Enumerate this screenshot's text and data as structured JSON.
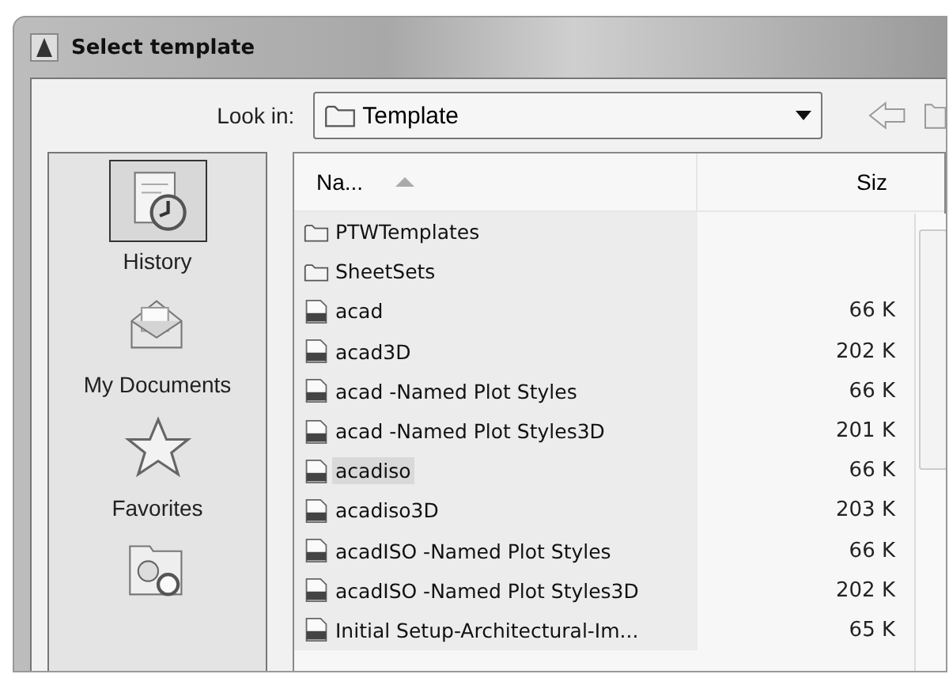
{
  "window": {
    "title": "Select template"
  },
  "look_in": {
    "label": "Look in:",
    "value": "Template"
  },
  "sidebar": {
    "items": [
      {
        "label": "History",
        "kind": "history",
        "selected": true
      },
      {
        "label": "My Documents",
        "kind": "documents",
        "selected": false
      },
      {
        "label": "Favorites",
        "kind": "favorites",
        "selected": false
      },
      {
        "kind": "search",
        "selected": false
      }
    ]
  },
  "table": {
    "columns": [
      "Na...",
      "Siz"
    ],
    "rows": [
      {
        "kind": "folder",
        "name": "PTWTemplates",
        "size": "",
        "selected": false
      },
      {
        "kind": "folder",
        "name": "SheetSets",
        "size": "",
        "selected": false
      },
      {
        "kind": "file",
        "name": "acad",
        "size": "66 K",
        "selected": false
      },
      {
        "kind": "file",
        "name": "acad3D",
        "size": "202 K",
        "selected": false
      },
      {
        "kind": "file",
        "name": "acad -Named Plot Styles",
        "size": "66 K",
        "selected": false
      },
      {
        "kind": "file",
        "name": "acad -Named Plot Styles3D",
        "size": "201 K",
        "selected": false
      },
      {
        "kind": "file",
        "name": "acadiso",
        "size": "66 K",
        "selected": true
      },
      {
        "kind": "file",
        "name": "acadiso3D",
        "size": "203 K",
        "selected": false
      },
      {
        "kind": "file",
        "name": "acadISO -Named Plot Styles",
        "size": "66 K",
        "selected": false
      },
      {
        "kind": "file",
        "name": "acadISO -Named Plot Styles3D",
        "size": "202 K",
        "selected": false
      },
      {
        "kind": "file",
        "name": "Initial Setup-Architectural-Im...",
        "size": "65 K",
        "selected": false
      }
    ]
  }
}
